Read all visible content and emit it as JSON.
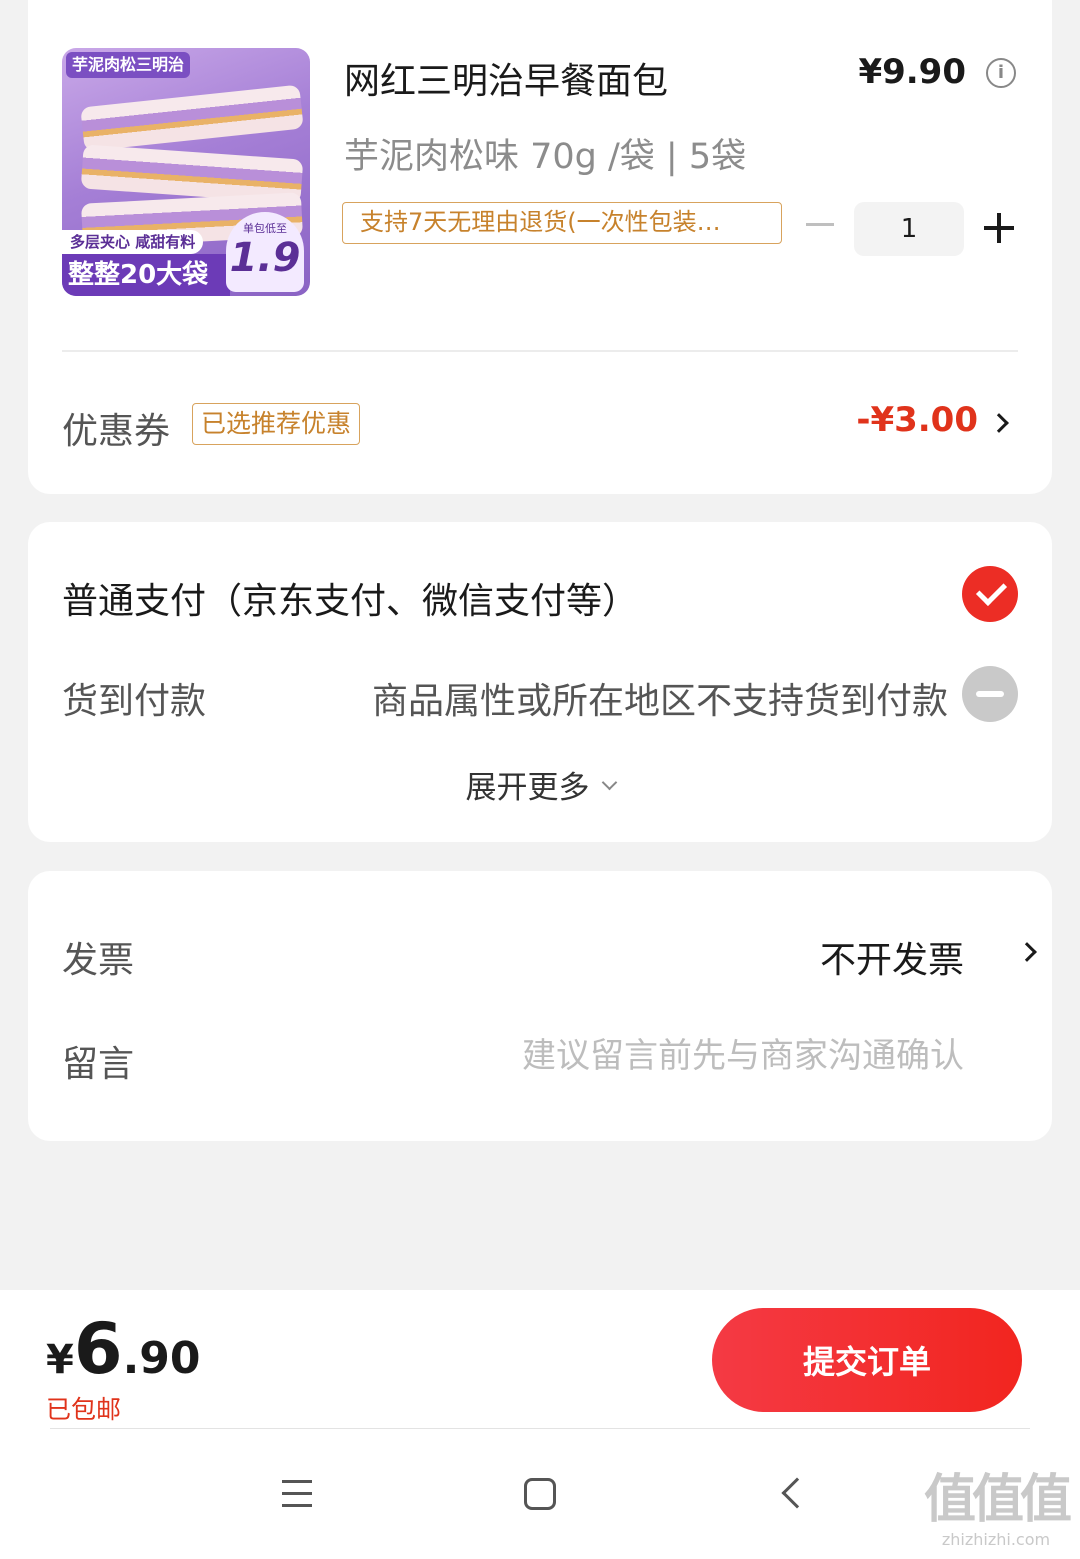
{
  "product": {
    "image": {
      "tag": "芋泥肉松三明治",
      "strip": "多层夹心 咸甜有料",
      "big_text": "整整20大袋",
      "price_note": "单包低至",
      "price_value": "1.9"
    },
    "title": "网红三明治早餐面包",
    "price": "¥9.90",
    "spec": "芋泥肉松味 70g /袋 | 5袋",
    "return_policy": "支持7天无理由退货(一次性包装…",
    "quantity": "1"
  },
  "coupon": {
    "label": "优惠券",
    "tag": "已选推荐优惠",
    "value": "-¥3.00"
  },
  "payment": {
    "normal": "普通支付（京东支付、微信支付等）",
    "cod_label": "货到付款",
    "cod_note": "商品属性或所在地区不支持货到付款",
    "expand": "展开更多"
  },
  "invoice": {
    "label": "发票",
    "value": "不开发票"
  },
  "message": {
    "label": "留言",
    "placeholder": "建议留言前先与商家沟通确认"
  },
  "footer": {
    "currency": "¥",
    "total_int": "6",
    "total_dec": ".90",
    "shipping": "已包邮",
    "submit": "提交订单"
  },
  "watermark": {
    "logo": "值值值",
    "site": "zhizhizhi.com"
  },
  "colors": {
    "accent_red": "#ec2d25",
    "price_red": "#e0331b",
    "tag_orange": "#c7822c"
  }
}
